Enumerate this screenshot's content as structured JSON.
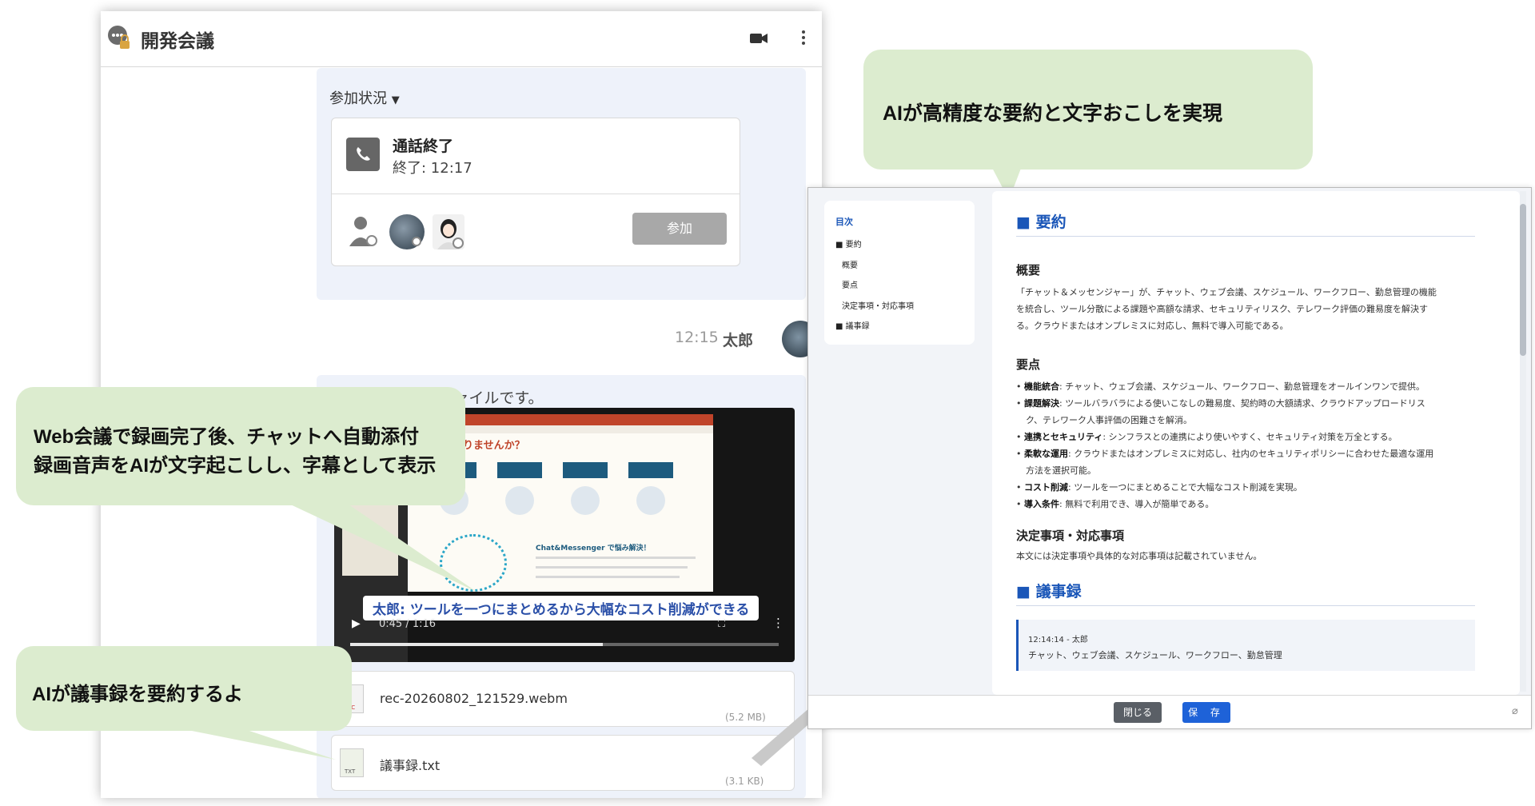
{
  "chat": {
    "title": "開発会議",
    "participation_label": "参加状況",
    "call_status": "通話終了",
    "call_end_time": "終了: 12:17",
    "join_button": "参加",
    "message_time": "12:15",
    "message_author": "太郎",
    "message_text": "Web会議の録画ファイルです。",
    "video": {
      "subtitle": "太郎: ツールを一つにまとめるから大幅なコスト削減ができる",
      "current_time": "0:45 / 1:16",
      "progress": 0.59,
      "slide_heading": "お悩みはありませんか？",
      "slide_label": "Chat&Messenger で悩み解決！"
    },
    "files": [
      {
        "name": "rec-20260802_121529.webm",
        "size": "(5.2 MB)",
        "type_label": "REC"
      },
      {
        "name": "議事録.txt",
        "size": "(3.1 KB)",
        "type_label": "TXT"
      }
    ]
  },
  "callouts": {
    "top_right": "AIが高精度な要約と文字おこしを実現",
    "left_line1": "Web会議で録画完了後、チャットへ自動添付",
    "left_line2": "録画音声をAIが文字起こしし、字幕として表示",
    "bottom_left": "AIが議事録を要約するよ"
  },
  "summary": {
    "toc": {
      "title": "目次",
      "items": [
        "■ 要約",
        "概要",
        "要点",
        "決定事項・対応事項",
        "■ 議事録"
      ]
    },
    "section_summary": "■ 要約",
    "overview_heading": "概要",
    "overview_text_1": "「チャット＆メッセンジャー」が、チャット、ウェブ会議、スケジュール、ワークフロー、勤怠管理の機能",
    "overview_text_2": "を統合し、ツール分散による課題や高額な請求、セキュリティリスク、テレワーク評価の難易度を解決す",
    "overview_text_3": "る。クラウドまたはオンプレミスに対応し、無料で導入可能である。",
    "points_heading": "要点",
    "points": [
      {
        "label": "機能統合",
        "text": ": チャット、ウェブ会議、スケジュール、ワークフロー、勤怠管理をオールインワンで提供。",
        "cont": ""
      },
      {
        "label": "課題解決",
        "text": ": ツールバラバラによる使いこなしの難易度、契約時の大額請求、クラウドアップロードリス",
        "cont": "ク、テレワーク人事評価の困難さを解消。"
      },
      {
        "label": "連携とセキュリティ",
        "text": ": シンフラスとの連携により使いやすく、セキュリティ対策を万全とする。",
        "cont": ""
      },
      {
        "label": "柔軟な運用",
        "text": ": クラウドまたはオンプレミスに対応し、社内のセキュリティポリシーに合わせた最適な運用",
        "cont": "方法を選択可能。"
      },
      {
        "label": "コスト削減",
        "text": ": ツールを一つにまとめることで大幅なコスト削減を実現。",
        "cont": ""
      },
      {
        "label": "導入条件",
        "text": ": 無料で利用でき、導入が簡単である。",
        "cont": ""
      }
    ],
    "decisions_heading": "決定事項・対応事項",
    "decisions_text": "本文には決定事項や具体的な対応事項は記載されていません。",
    "section_minutes": "■ 議事録",
    "minute_time": "12:14:14 - 太郎",
    "minute_text": "チャット、ウェブ会議、スケジュール、ワークフロー、勤怠管理",
    "close_button": "閉じる",
    "save_button": "保 存"
  },
  "colors": {
    "callout_bg": "#dceccf",
    "accent_blue": "#1a56b8",
    "save_blue": "#1e62d8",
    "chat_bubble_bg": "#eef2fa"
  }
}
